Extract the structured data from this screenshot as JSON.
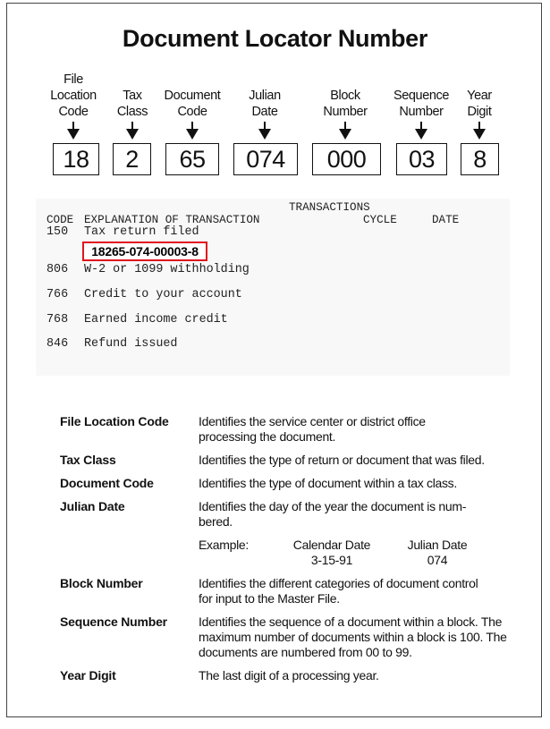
{
  "title": "Document Locator Number",
  "dln_parts": [
    {
      "label": "File\nLocation\nCode",
      "value": "18"
    },
    {
      "label": "Tax\nClass",
      "value": "2"
    },
    {
      "label": "Document\nCode",
      "value": "65"
    },
    {
      "label": "Julian\nDate",
      "value": "074"
    },
    {
      "label": "Block\nNumber",
      "value": "000"
    },
    {
      "label": "Sequence\nNumber",
      "value": "03"
    },
    {
      "label": "Year\nDigit",
      "value": "8"
    }
  ],
  "transactions": {
    "section_title": "TRANSACTIONS",
    "headers": {
      "code": "CODE",
      "explanation": "EXPLANATION OF TRANSACTION",
      "cycle": "CYCLE",
      "date": "DATE"
    },
    "rows": [
      {
        "code": "150",
        "explanation": "Tax return filed"
      },
      {
        "code": "806",
        "explanation": "W-2 or 1099 withholding"
      },
      {
        "code": "766",
        "explanation": "Credit to your account"
      },
      {
        "code": "768",
        "explanation": "Earned income credit"
      },
      {
        "code": "846",
        "explanation": "Refund issued"
      }
    ],
    "highlighted_dln": "18265-074-00003-8",
    "highlight_color": "#e0141e"
  },
  "definitions": [
    {
      "term": "File Location Code",
      "text": "Identifies the service center or district office processing the document."
    },
    {
      "term": "Tax Class",
      "text": "Identifies the type of return or document that was filed."
    },
    {
      "term": "Document Code",
      "text": "Identifies the type of document within a tax class."
    },
    {
      "term": "Julian Date",
      "text": "Identifies the day of the year the document is num-bered."
    },
    {
      "term": "Block Number",
      "text": "Identifies the different categories of document control for input to the Master File."
    },
    {
      "term": "Sequence Number",
      "text": "Identifies the sequence of a document within a block. The maximum number of documents within a block is 100. The documents are numbered from 00 to 99."
    },
    {
      "term": "Year Digit",
      "text": "The last digit of a processing year."
    }
  ],
  "julian_example": {
    "label": "Example:",
    "calendar_header": "Calendar Date",
    "calendar_value": "3-15-91",
    "julian_header": "Julian Date",
    "julian_value": "074"
  }
}
